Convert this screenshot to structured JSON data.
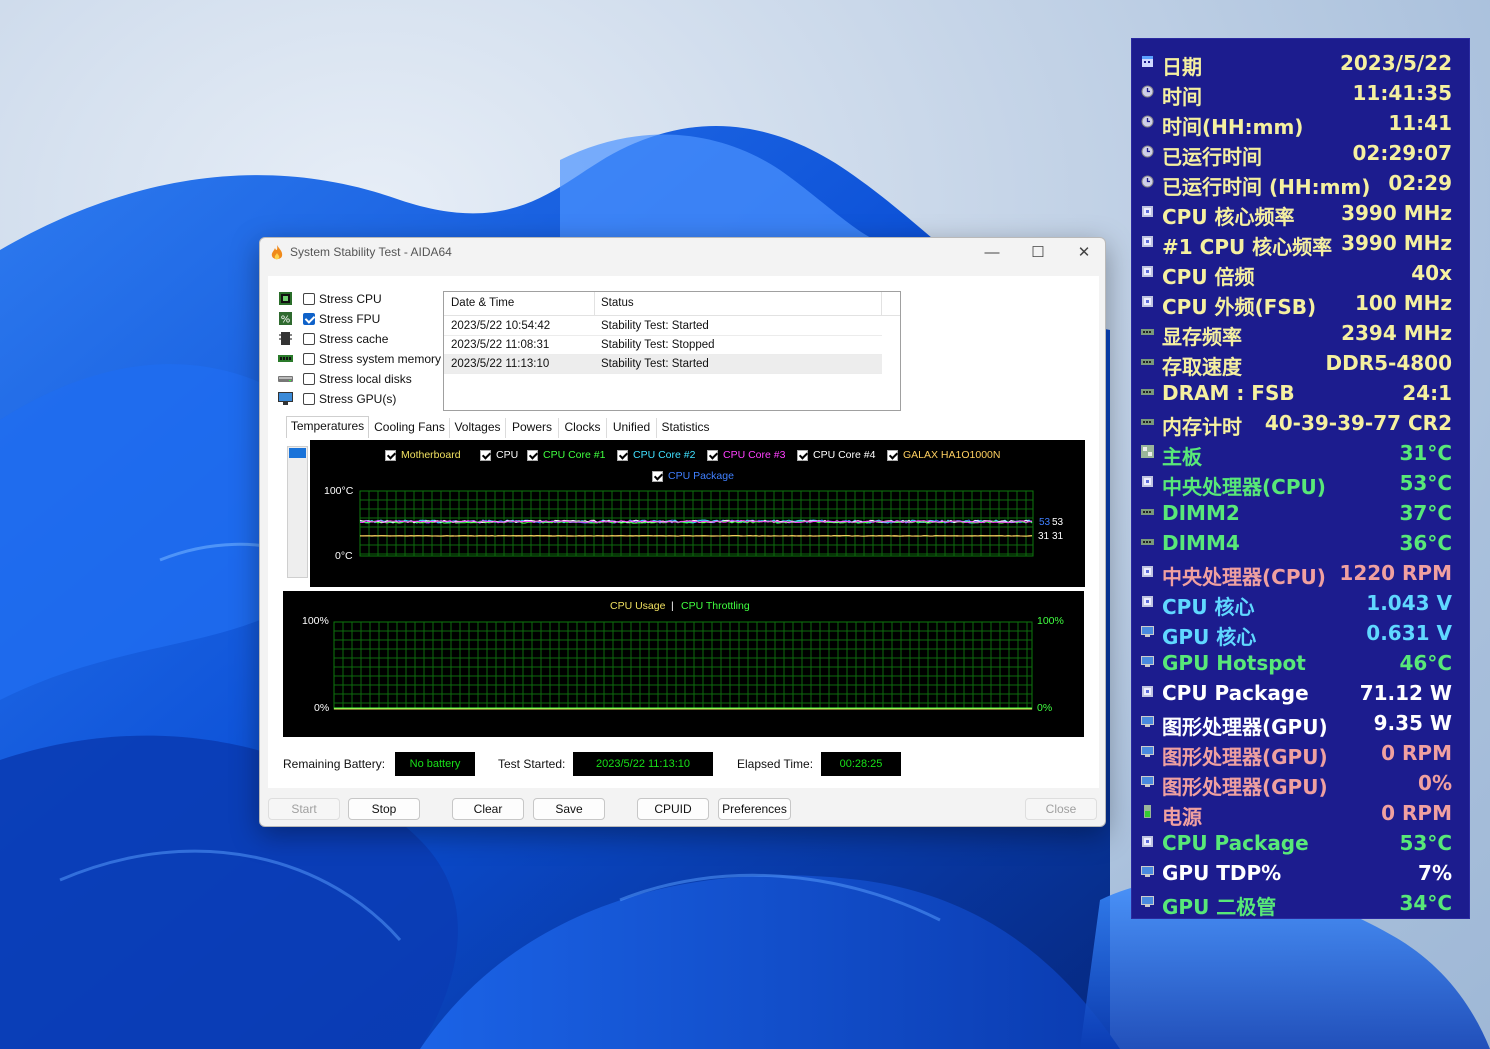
{
  "window": {
    "title": "System Stability Test - AIDA64",
    "controls": {
      "minimize": "—",
      "maximize": "☐",
      "close": "✕"
    }
  },
  "stress_options": [
    {
      "label": "Stress CPU",
      "checked": false,
      "icon": "cpu-chip-icon"
    },
    {
      "label": "Stress FPU",
      "checked": true,
      "icon": "fpu-percent-icon"
    },
    {
      "label": "Stress cache",
      "checked": false,
      "icon": "cache-chip-icon"
    },
    {
      "label": "Stress system memory",
      "checked": false,
      "icon": "memory-module-icon"
    },
    {
      "label": "Stress local disks",
      "checked": false,
      "icon": "disk-drive-icon"
    },
    {
      "label": "Stress GPU(s)",
      "checked": false,
      "icon": "monitor-icon"
    }
  ],
  "log": {
    "headers": [
      "Date & Time",
      "Status"
    ],
    "rows": [
      {
        "datetime": "2023/5/22 10:54:42",
        "status": "Stability Test: Started"
      },
      {
        "datetime": "2023/5/22 11:08:31",
        "status": "Stability Test: Stopped"
      },
      {
        "datetime": "2023/5/22 11:13:10",
        "status": "Stability Test: Started"
      }
    ]
  },
  "tabs": [
    "Temperatures",
    "Cooling Fans",
    "Voltages",
    "Powers",
    "Clocks",
    "Unified",
    "Statistics"
  ],
  "active_tab": "Temperatures",
  "temp_graph": {
    "legend": [
      {
        "label": "Motherboard",
        "color": "#f0e060"
      },
      {
        "label": "CPU",
        "color": "#ffffff"
      },
      {
        "label": "CPU Core #1",
        "color": "#40ff40"
      },
      {
        "label": "CPU Core #2",
        "color": "#40e0ff"
      },
      {
        "label": "CPU Core #3",
        "color": "#ff40ff"
      },
      {
        "label": "CPU Core #4",
        "color": "#ffffff"
      },
      {
        "label": "GALAX HA1O1000N",
        "color": "#ffd060"
      },
      {
        "label": "CPU Package",
        "color": "#4080ff"
      }
    ],
    "y_max_label": "100°C",
    "y_min_label": "0°C",
    "end_labels": {
      "upper_a": "53",
      "upper_b": "53",
      "lower_a": "31",
      "lower_b": "31"
    }
  },
  "usage_graph": {
    "legend_cpu": "CPU Usage",
    "separator": "|",
    "legend_throttle": "CPU Throttling",
    "left_top": "100%",
    "left_bottom": "0%",
    "right_top": "100%",
    "right_bottom": "0%",
    "colors": {
      "cpu_usage": "#f0e060",
      "throttling": "#40ff40"
    }
  },
  "chart_data": [
    {
      "type": "line",
      "title": "",
      "ylim": [
        0,
        100
      ],
      "y_unit": "°C",
      "grid": true,
      "legend_placement": "top-center",
      "series": [
        {
          "name": "CPU Package",
          "last_value": 53
        },
        {
          "name": "CPU",
          "last_value": 53
        },
        {
          "name": "Motherboard",
          "last_value": 31
        },
        {
          "name": "GALAX HA1O1000N",
          "last_value": 31
        }
      ]
    },
    {
      "type": "line",
      "title": "",
      "ylim": [
        0,
        100
      ],
      "y_unit": "%",
      "grid": true,
      "legend_placement": "top-center",
      "series": [
        {
          "name": "CPU Usage",
          "last_value": 0
        },
        {
          "name": "CPU Throttling",
          "last_value": 0
        }
      ]
    }
  ],
  "status": {
    "battery_label": "Remaining Battery:",
    "battery_value": "No battery",
    "started_label": "Test Started:",
    "started_value": "2023/5/22 11:13:10",
    "elapsed_label": "Elapsed Time:",
    "elapsed_value": "00:28:25"
  },
  "buttons": {
    "start": "Start",
    "stop": "Stop",
    "clear": "Clear",
    "save": "Save",
    "cpuid": "CPUID",
    "preferences": "Preferences",
    "close": "Close"
  },
  "osd": [
    {
      "label": "日期",
      "value": "2023/5/22",
      "color": "#f5f0a0",
      "icon": "calendar-icon"
    },
    {
      "label": "时间",
      "value": "11:41:35",
      "color": "#f5f0a0",
      "icon": "clock-icon"
    },
    {
      "label": "时间(HH:mm)",
      "value": "11:41",
      "color": "#f5f0a0",
      "icon": "clock-icon"
    },
    {
      "label": "已运行时间",
      "value": "02:29:07",
      "color": "#f5f0a0",
      "icon": "clock-icon"
    },
    {
      "label": "已运行时间 (HH:mm)",
      "value": "02:29",
      "color": "#f5f0a0",
      "icon": "clock-icon"
    },
    {
      "label": "CPU 核心频率",
      "value": "3990 MHz",
      "color": "#f5f0a0",
      "icon": "cpu-chip-icon"
    },
    {
      "label": "#1 CPU 核心频率",
      "value": "3990 MHz",
      "color": "#f5f0a0",
      "icon": "cpu-chip-icon"
    },
    {
      "label": "CPU 倍频",
      "value": "40x",
      "color": "#f5f0a0",
      "icon": "cpu-chip-icon"
    },
    {
      "label": "CPU 外频(FSB)",
      "value": "100 MHz",
      "color": "#f5f0a0",
      "icon": "cpu-chip-icon"
    },
    {
      "label": "显存频率",
      "value": "2394 MHz",
      "color": "#f5f0a0",
      "icon": "memory-module-icon"
    },
    {
      "label": "存取速度",
      "value": "DDR5-4800",
      "color": "#f5f0a0",
      "icon": "memory-module-icon"
    },
    {
      "label": "DRAM : FSB",
      "value": "24:1",
      "color": "#f5f0a0",
      "icon": "memory-module-icon"
    },
    {
      "label": "内存计时",
      "value": "40-39-39-77 CR2",
      "color": "#f5f0a0",
      "icon": "memory-module-icon"
    },
    {
      "label": "主板",
      "value": "31°C",
      "color": "#58e878",
      "icon": "motherboard-icon"
    },
    {
      "label": "中央处理器(CPU)",
      "value": "53°C",
      "color": "#58e878",
      "icon": "cpu-chip-icon"
    },
    {
      "label": "DIMM2",
      "value": "37°C",
      "color": "#58e878",
      "icon": "memory-module-icon"
    },
    {
      "label": "DIMM4",
      "value": "36°C",
      "color": "#58e878",
      "icon": "memory-module-icon"
    },
    {
      "label": "中央处理器(CPU)",
      "value": "1220 RPM",
      "color": "#f0a0a0",
      "icon": "cpu-chip-icon"
    },
    {
      "label": "CPU 核心",
      "value": "1.043 V",
      "color": "#60d8ff",
      "icon": "cpu-chip-icon"
    },
    {
      "label": "GPU 核心",
      "value": "0.631 V",
      "color": "#60d8ff",
      "icon": "monitor-icon"
    },
    {
      "label": "GPU Hotspot",
      "value": "46°C",
      "color": "#58e878",
      "icon": "monitor-icon"
    },
    {
      "label": "CPU Package",
      "value": "71.12 W",
      "color": "#ffffff",
      "icon": "cpu-chip-icon"
    },
    {
      "label": "图形处理器(GPU)",
      "value": "9.35 W",
      "color": "#ffffff",
      "icon": "monitor-icon"
    },
    {
      "label": "图形处理器(GPU)",
      "value": "0 RPM",
      "color": "#f0a0a0",
      "icon": "monitor-icon"
    },
    {
      "label": "图形处理器(GPU)",
      "value": "0%",
      "color": "#f0a0a0",
      "icon": "monitor-icon"
    },
    {
      "label": "电源",
      "value": "0 RPM",
      "color": "#f0a0a0",
      "icon": "battery-icon"
    },
    {
      "label": "CPU Package",
      "value": "53°C",
      "color": "#58e878",
      "icon": "cpu-chip-icon"
    },
    {
      "label": "GPU TDP%",
      "value": "7%",
      "color": "#ffffff",
      "icon": "monitor-icon"
    },
    {
      "label": "GPU 二极管",
      "value": "34°C",
      "color": "#58e878",
      "icon": "monitor-icon"
    }
  ]
}
